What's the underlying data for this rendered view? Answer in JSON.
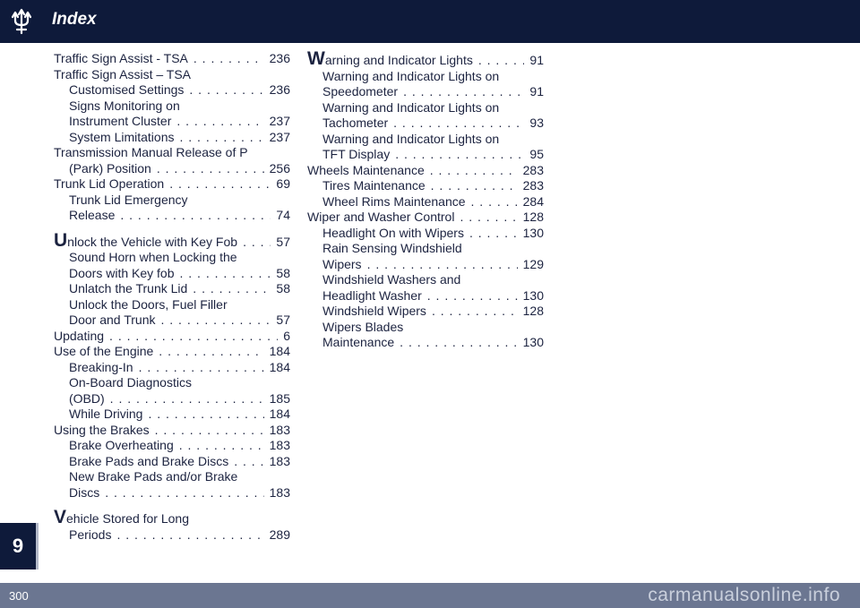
{
  "header": {
    "title": "Index"
  },
  "chapter_tab": "9",
  "footer": {
    "page_number": "300",
    "watermark": "carmanualsonline.info"
  },
  "col1": {
    "e1": {
      "title": "Traffic Sign Assist - TSA",
      "page": "236"
    },
    "e2": {
      "title": "Traffic Sign Assist – TSA"
    },
    "e3": {
      "title": "Customised Settings",
      "page": "236"
    },
    "e4": {
      "line1": "Signs Monitoring on",
      "line2": "Instrument Cluster",
      "page": "237"
    },
    "e5": {
      "title": "System Limitations",
      "page": "237"
    },
    "e6": {
      "line1": "Transmission Manual Release of P",
      "line2": "(Park) Position",
      "page": "256"
    },
    "e7": {
      "title": "Trunk Lid Operation",
      "page": "69"
    },
    "e8": {
      "line1": "Trunk Lid Emergency",
      "line2": "Release",
      "page": "74"
    },
    "e9": {
      "first": "U",
      "rest": "nlock the Vehicle with Key Fob",
      "page": "57"
    },
    "e10": {
      "line1": "Sound Horn when Locking the",
      "line2": "Doors with Key fob",
      "page": "58"
    },
    "e11": {
      "title": "Unlatch the Trunk Lid",
      "page": "58"
    },
    "e12": {
      "line1": "Unlock the Doors, Fuel Filler",
      "line2": "Door and Trunk",
      "page": "57"
    },
    "e13": {
      "title": "Updating",
      "page": "6"
    },
    "e14": {
      "title": "Use of the Engine",
      "page": "184"
    },
    "e15": {
      "title": "Breaking-In",
      "page": "184"
    },
    "e16": {
      "line1": "On-Board Diagnostics",
      "line2": "(OBD)",
      "page": "185"
    },
    "e17": {
      "title": "While Driving",
      "page": "184"
    },
    "e18": {
      "title": "Using the Brakes",
      "page": "183"
    },
    "e19": {
      "title": "Brake Overheating",
      "page": "183"
    },
    "e20": {
      "title": "Brake Pads and Brake Discs",
      "page": "183"
    },
    "e21": {
      "line1": "New Brake Pads and/or Brake",
      "line2": "Discs",
      "page": "183"
    },
    "e22": {
      "first": "V",
      "rest": "ehicle Stored for Long",
      "line2": "Periods",
      "page": "289"
    }
  },
  "col2": {
    "e1": {
      "first": "W",
      "rest": "arning and Indicator Lights",
      "page": "91"
    },
    "e2": {
      "line1": "Warning and Indicator Lights on",
      "line2": "Speedometer",
      "page": "91"
    },
    "e3": {
      "line1": "Warning and Indicator Lights on",
      "line2": "Tachometer",
      "page": "93"
    },
    "e4": {
      "line1": "Warning and Indicator Lights on",
      "line2": "TFT Display",
      "page": "95"
    },
    "e5": {
      "title": "Wheels Maintenance",
      "page": "283"
    },
    "e6": {
      "title": "Tires Maintenance",
      "page": "283"
    },
    "e7": {
      "title": "Wheel Rims Maintenance",
      "page": "284"
    },
    "e8": {
      "title": "Wiper and Washer Control",
      "page": "128"
    },
    "e9": {
      "title": "Headlight On with Wipers",
      "page": "130"
    },
    "e10": {
      "line1": "Rain Sensing Windshield",
      "line2": "Wipers",
      "page": "129"
    },
    "e11": {
      "line1": "Windshield Washers and",
      "line2": "Headlight Washer",
      "page": "130"
    },
    "e12": {
      "title": "Windshield Wipers",
      "page": "128"
    },
    "e13": {
      "line1": "Wipers Blades",
      "line2": "Maintenance",
      "page": "130"
    }
  }
}
